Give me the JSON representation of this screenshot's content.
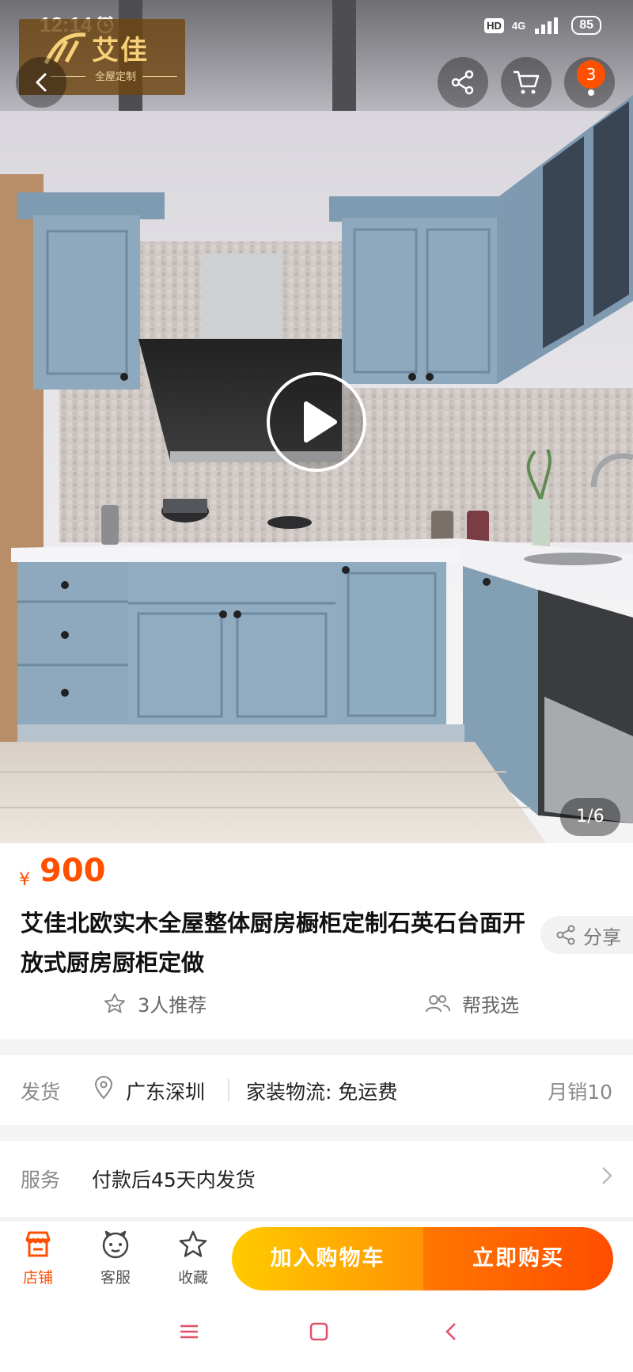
{
  "status_bar": {
    "time": "12:14",
    "hd": "HD",
    "network": "4G",
    "battery": "85",
    "icons": [
      "alarm-icon",
      "signal-icon"
    ]
  },
  "brand": {
    "name": "艾佳",
    "tagline": "全屋定制"
  },
  "header": {
    "cart_badge": "3",
    "icons": [
      "back-icon",
      "share-icon",
      "cart-icon"
    ]
  },
  "gallery": {
    "indicator": "1/6",
    "icons": [
      "play-icon"
    ]
  },
  "product": {
    "currency": "¥",
    "price": "900",
    "title": "艾佳北欧实木全屋整体厨房橱柜定制石英石台面开放式厨房厨柜定做",
    "share_label": "分享",
    "recommend_label": "3人推荐",
    "help_choose_label": "帮我选"
  },
  "shipping": {
    "label": "发货",
    "origin": "广东深圳",
    "method": "家装物流: 免运费",
    "monthly_sales": "月销10"
  },
  "service": {
    "label": "服务",
    "text": "付款后45天内发货"
  },
  "action_bar": {
    "store_label": "店铺",
    "service_label": "客服",
    "favorite_label": "收藏",
    "add_to_cart_label": "加入购物车",
    "buy_now_label": "立即购买"
  },
  "colors": {
    "accent": "#ff5000",
    "cart_button": "#ffb000",
    "buy_button": "#ff5d00",
    "cabinet": "#7fa0b8"
  }
}
